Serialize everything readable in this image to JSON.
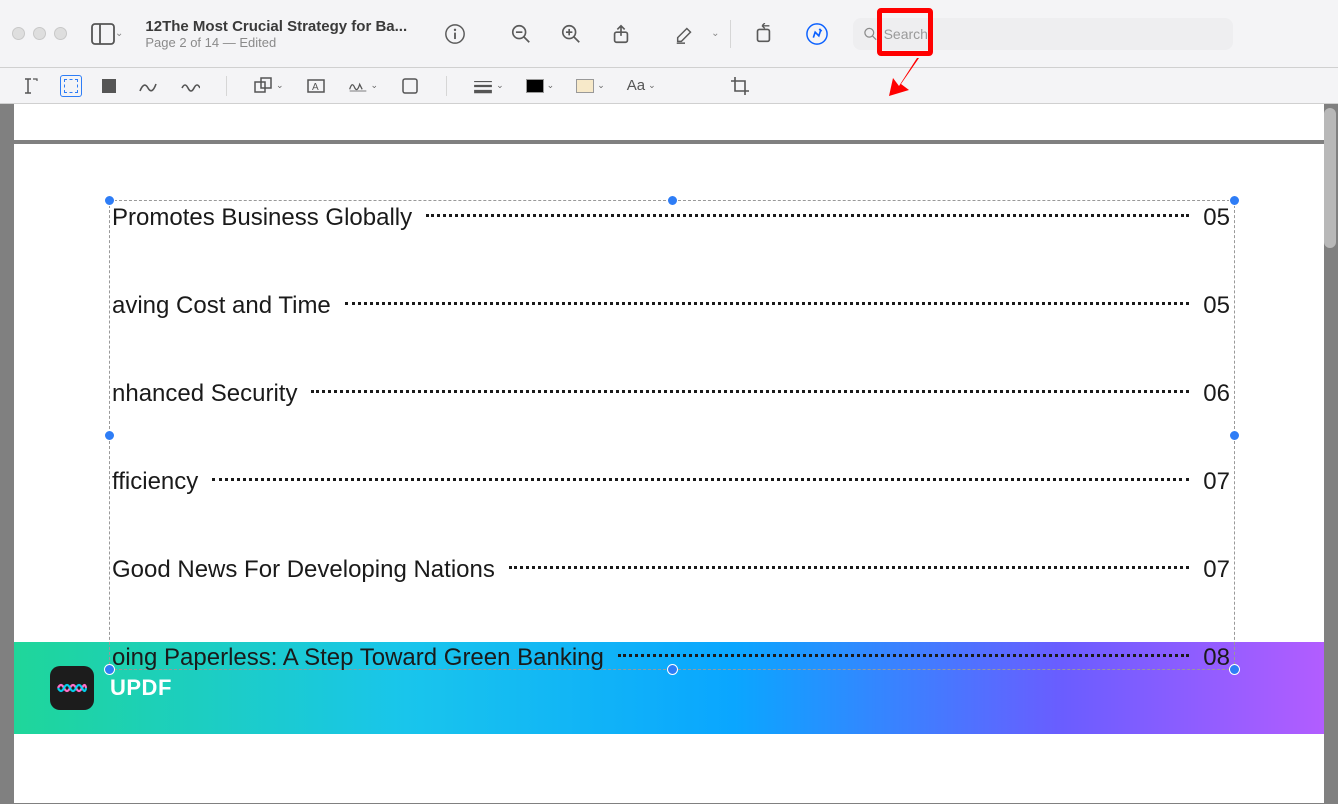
{
  "header": {
    "title": "12The Most Crucial Strategy for Ba...",
    "subtitle": "Page 2 of 14 — Edited"
  },
  "search": {
    "placeholder": "Search"
  },
  "toc": [
    {
      "title": "Promotes Business Globally",
      "page": "05"
    },
    {
      "title": "aving Cost and Time",
      "page": "05"
    },
    {
      "title": "nhanced Security",
      "page": "06"
    },
    {
      "title": "fficiency",
      "page": "07"
    },
    {
      "title": " Good News For Developing Nations",
      "page": "07"
    },
    {
      "title": "oing Paperless: A Step Toward Green Banking",
      "page": "08"
    }
  ],
  "banner": {
    "brand": "UPDF"
  },
  "second_toolbar": {
    "aa_label": "Aa"
  }
}
